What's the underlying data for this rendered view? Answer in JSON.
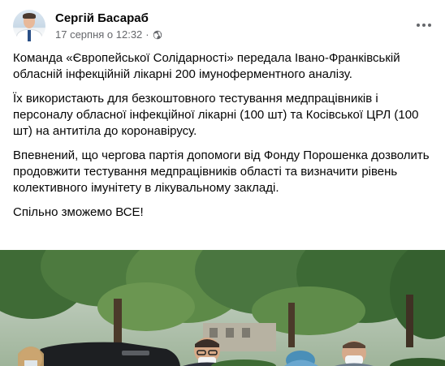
{
  "post": {
    "author": "Сергій Басараб",
    "timestamp": "17 серпня о 12:32",
    "separator": "·",
    "privacy_icon": "globe-icon",
    "more_icon": "more-options-icon",
    "paragraphs": [
      "Команда «Європейської Солідарності» передала Івано-Франківській обласній інфекційній лікарні 200 імуноферментного аналізу.",
      "Їх використають для безкоштовного тестування медпрацівників і персоналу обласної інфекційної лікарні (100 шт) та Косівської ЦРЛ (100 шт) на антитіла до коронавірусу.",
      "Впевнений, що чергова партія допомоги від Фонду Порошенка дозволить продовжити тестування медпрацівників області та визначити рівень колективного імунітету в лікувальному закладі.",
      "Спільно зможемо ВСЕ!"
    ]
  },
  "colors": {
    "text_primary": "#050505",
    "text_secondary": "#65676b",
    "background": "#ffffff"
  }
}
